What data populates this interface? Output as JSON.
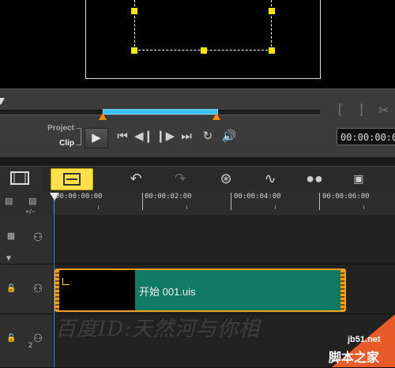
{
  "player": {
    "mode_project": "Project",
    "mode_clip": "Clip",
    "timecode": "00:00:00:0",
    "bracket_in": "[",
    "bracket_out": "]"
  },
  "toolbar": {
    "items": [
      "storyboard-view",
      "timeline-view",
      "undo",
      "redo",
      "record-capture",
      "sound-mixer",
      "auto-music",
      "title"
    ]
  },
  "ruler": {
    "ticks": [
      "00:00:00:00",
      "00:00:02:00",
      "00:00:04:00",
      "00:00:06:00"
    ],
    "zoom_control": "+/−"
  },
  "tracks": [
    {
      "name": "video-track",
      "has_clip": false
    },
    {
      "name": "overlay-track-1",
      "has_clip": true
    },
    {
      "name": "overlay-track-2",
      "track_number": "2",
      "has_clip": false
    }
  ],
  "clip": {
    "label": "开始 001.uis"
  },
  "watermarks": {
    "baidu": "百度ID:天然河与你相",
    "site": "jb51.net",
    "site_name": "脚本之家"
  },
  "colors": {
    "clip_fill": "#117a64",
    "clip_border": "#f0a020",
    "scrub_range": "#3cc0f0",
    "selection_handles": "#ffe600",
    "timeline_button_active": "#ffe04a"
  }
}
